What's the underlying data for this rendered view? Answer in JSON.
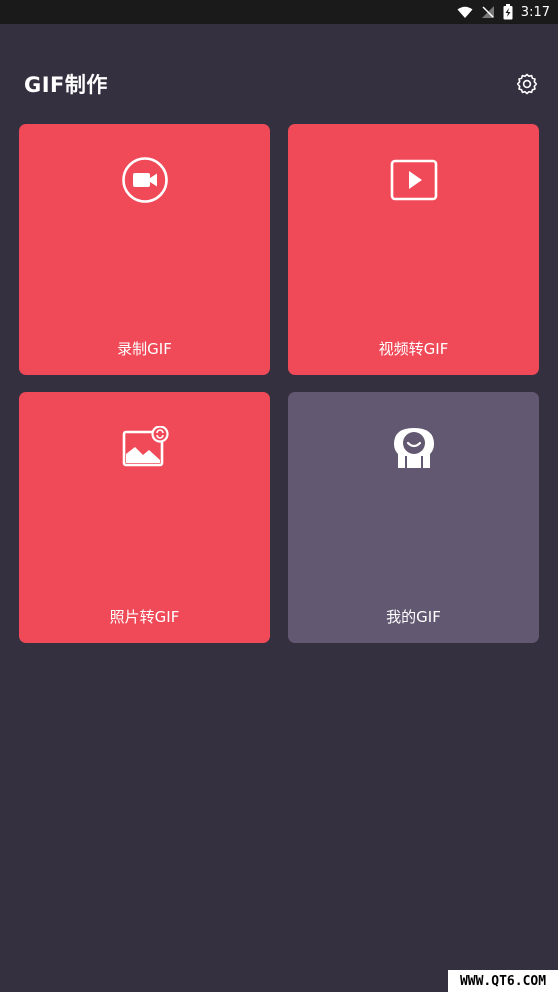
{
  "status_bar": {
    "time": "3:17",
    "icons": [
      "wifi-icon",
      "signal-off-icon",
      "battery-charging-icon"
    ]
  },
  "header": {
    "title": "GIF制作",
    "settings_icon": "gear-icon"
  },
  "tiles": [
    {
      "label": "录制GIF",
      "icon": "video-camera-icon",
      "color": "#f04a58"
    },
    {
      "label": "视频转GIF",
      "icon": "play-icon",
      "color": "#f04a58"
    },
    {
      "label": "照片转GIF",
      "icon": "image-convert-icon",
      "color": "#f04a58"
    },
    {
      "label": "我的GIF",
      "icon": "smiling-character-icon",
      "color": "#635871"
    }
  ],
  "colors": {
    "background": "#353040",
    "accent": "#f04a58",
    "secondary": "#635871"
  },
  "watermark": "WWW.QT6.COM"
}
